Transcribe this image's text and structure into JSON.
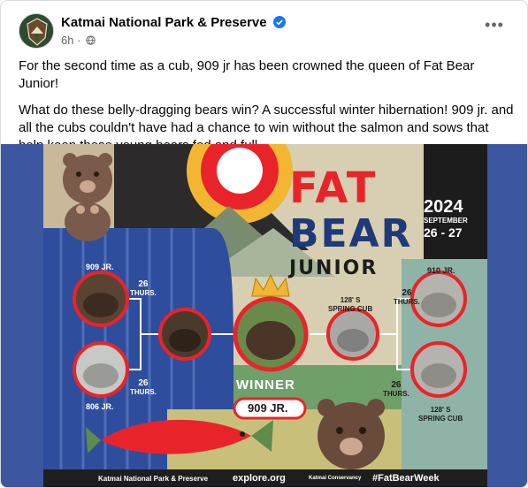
{
  "post": {
    "page_name": "Katmai National Park & Preserve",
    "time": "6h",
    "separator": "·",
    "more_label": "•••",
    "paragraphs": [
      "For the second time as a cub, 909 jr has been crowned the queen of Fat Bear Junior!",
      "What do these belly-dragging bears win? A successful winter hibernation! 909 jr. and all the cubs couldn't have had a chance to win without the salmon and sows that help keep these young bears fed and full"
    ]
  },
  "poster": {
    "title_line1": "FAT",
    "title_line2": "BEAR",
    "title_line3": "JUNIOR",
    "year": "2024",
    "date_month": "SEPTEMBER",
    "date_days": "26 - 27",
    "left_top_label": "909 JR.",
    "left_bottom_label": "806 JR.",
    "left_top_seed": "26",
    "left_top_seed_day": "THURS.",
    "left_bottom_seed": "26",
    "left_bottom_seed_day": "THURS.",
    "right_top_label": "910 JR.",
    "right_mid_label_1": "128' S",
    "right_mid_label_2": "SPRING CUB",
    "right_seed_top": "26",
    "right_seed_top_day": "THURS.",
    "right_seed_bottom": "26",
    "right_seed_bottom_day": "THURS.",
    "right_bottom_label_1": "128' S",
    "right_bottom_label_2": "SPRING CUB",
    "winner_label": "WINNER",
    "winner_name": "909 JR.",
    "footer_left": "Katmai National Park & Preserve",
    "footer_mid": "explore.org",
    "footer_conservancy": "Katmai Conservancy",
    "footer_hashtag": "#FatBearWeek"
  },
  "colors": {
    "facebook_blue": "#1877f2",
    "poster_red": "#e8242a",
    "poster_navy": "#1f3a7a",
    "poster_yellow": "#f2b632"
  }
}
